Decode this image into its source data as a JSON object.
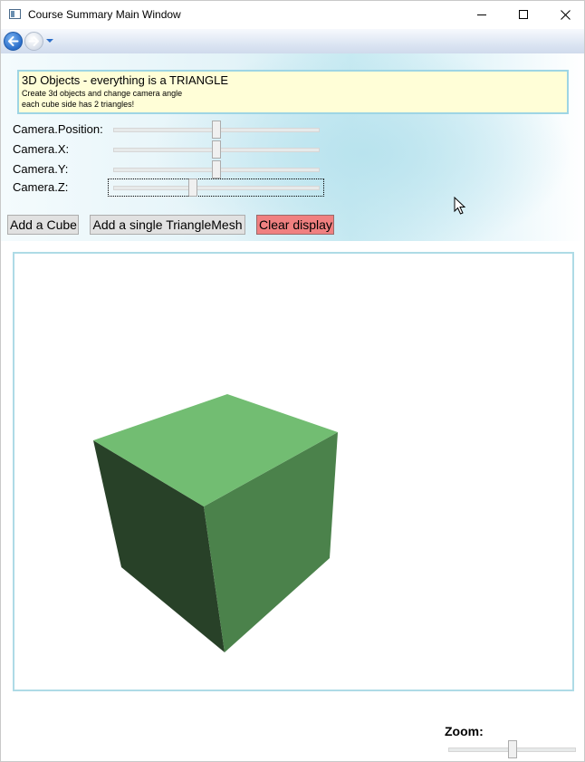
{
  "window": {
    "title": "Course Summary Main Window"
  },
  "nav": {
    "back_icon": "back-arrow-icon",
    "forward_icon": "forward-arrow-icon"
  },
  "info": {
    "title": "3D Objects - everything is a TRIANGLE",
    "line1": "Create 3d objects and change camera angle",
    "line2": "each cube side has 2 triangles!"
  },
  "sliders": [
    {
      "label": "Camera.Position:",
      "value_fraction": 0.5
    },
    {
      "label": "Camera.X:",
      "value_fraction": 0.5
    },
    {
      "label": "Camera.Y:",
      "value_fraction": 0.5
    },
    {
      "label": "Camera.Z:",
      "value_fraction": 0.38
    }
  ],
  "buttons": {
    "add_cube": "Add a Cube",
    "add_triangle_mesh": "Add a single TriangleMesh",
    "clear_display": "Clear display"
  },
  "cube": {
    "top_color": "#72bd72",
    "left_color": "#284128",
    "right_color": "#4b824b"
  },
  "zoom": {
    "label": "Zoom:",
    "value_fraction": 0.5
  },
  "colors": {
    "info_background": "#fffed7",
    "clear_button": "#f08080",
    "border_accent": "#aedbe6"
  }
}
